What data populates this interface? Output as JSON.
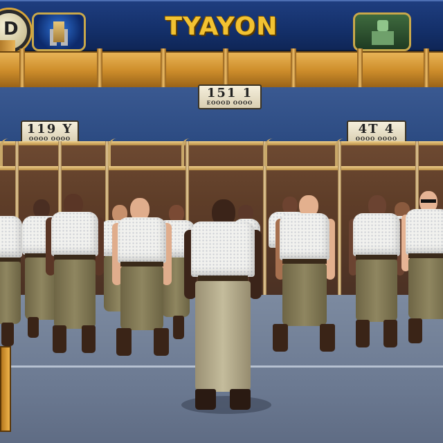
{
  "hud": {
    "title": "TYAYON",
    "left_badge": "D",
    "icons": [
      "prison-tower-icon",
      "guard-portrait-icon"
    ]
  },
  "signs": {
    "center": {
      "big": "151 1",
      "small": "EOOOD OOOO"
    },
    "left": {
      "big": "119 Y",
      "small": "OOOO OOOO"
    },
    "right": {
      "big": "4T 4",
      "small": "OOOO OOOO"
    }
  },
  "colors": {
    "hud_blue": "#14306a",
    "title_gold": "#f2c232",
    "pipe_orange": "#cf8f2c",
    "wall_blue": "#2c4b82",
    "shirt_white": "#f1f1ee",
    "pants_khaki": "#8f8660"
  }
}
